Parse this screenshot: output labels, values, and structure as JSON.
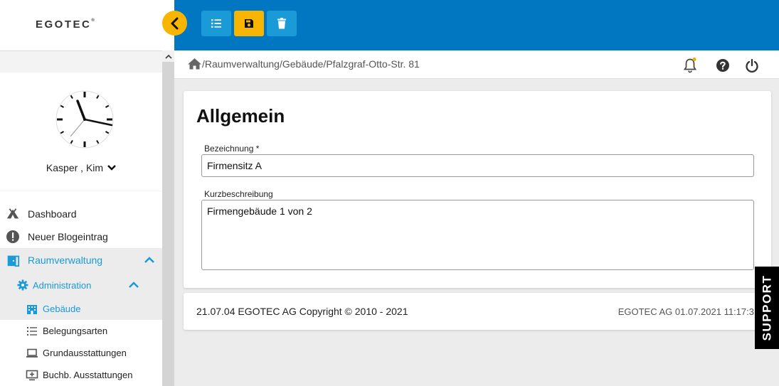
{
  "app": {
    "logo_text": "EGOTEC",
    "logo_mark": "®"
  },
  "toolbar": {
    "list_icon": "list-icon",
    "save_icon": "save-icon",
    "delete_icon": "trash-icon",
    "colors": {
      "topbar": "#0077c0",
      "list_btn": "#1a9ad6",
      "save_btn": "#f7b500",
      "delete_btn": "#1a9ad6"
    }
  },
  "breadcrumb": {
    "path": "/Raumverwaltung/Gebäude/Pfalzgraf-Otto-Str. 81"
  },
  "user": {
    "name": "Kasper , Kim"
  },
  "sidebar": {
    "items": [
      {
        "label": "Dashboard",
        "icon": "campfire-icon"
      },
      {
        "label": "Neuer Blogeintrag",
        "icon": "alert-icon"
      },
      {
        "label": "Raumverwaltung",
        "icon": "door-icon"
      },
      {
        "label": "Administration",
        "icon": "gear-icon"
      },
      {
        "label": "Gebäude",
        "icon": "building-icon"
      },
      {
        "label": "Belegungsarten",
        "icon": "list-icon"
      },
      {
        "label": "Grundausstattungen",
        "icon": "laptop-icon"
      },
      {
        "label": "Buchb. Ausstattungen",
        "icon": "monitor-plus-icon"
      }
    ]
  },
  "form": {
    "title": "Allgemein",
    "bezeichnung_label": "Bezeichnung *",
    "bezeichnung_value": "Firmensitz A",
    "kurz_label": "Kurzbeschreibung",
    "kurz_value": "Firmengebäude 1 von 2"
  },
  "footer": {
    "left": "21.07.04 EGOTEC AG Copyright © 2010 - 2021",
    "right": "EGOTEC AG  01.07.2021 11:17:3"
  },
  "support": {
    "label": "SUPPORT"
  }
}
